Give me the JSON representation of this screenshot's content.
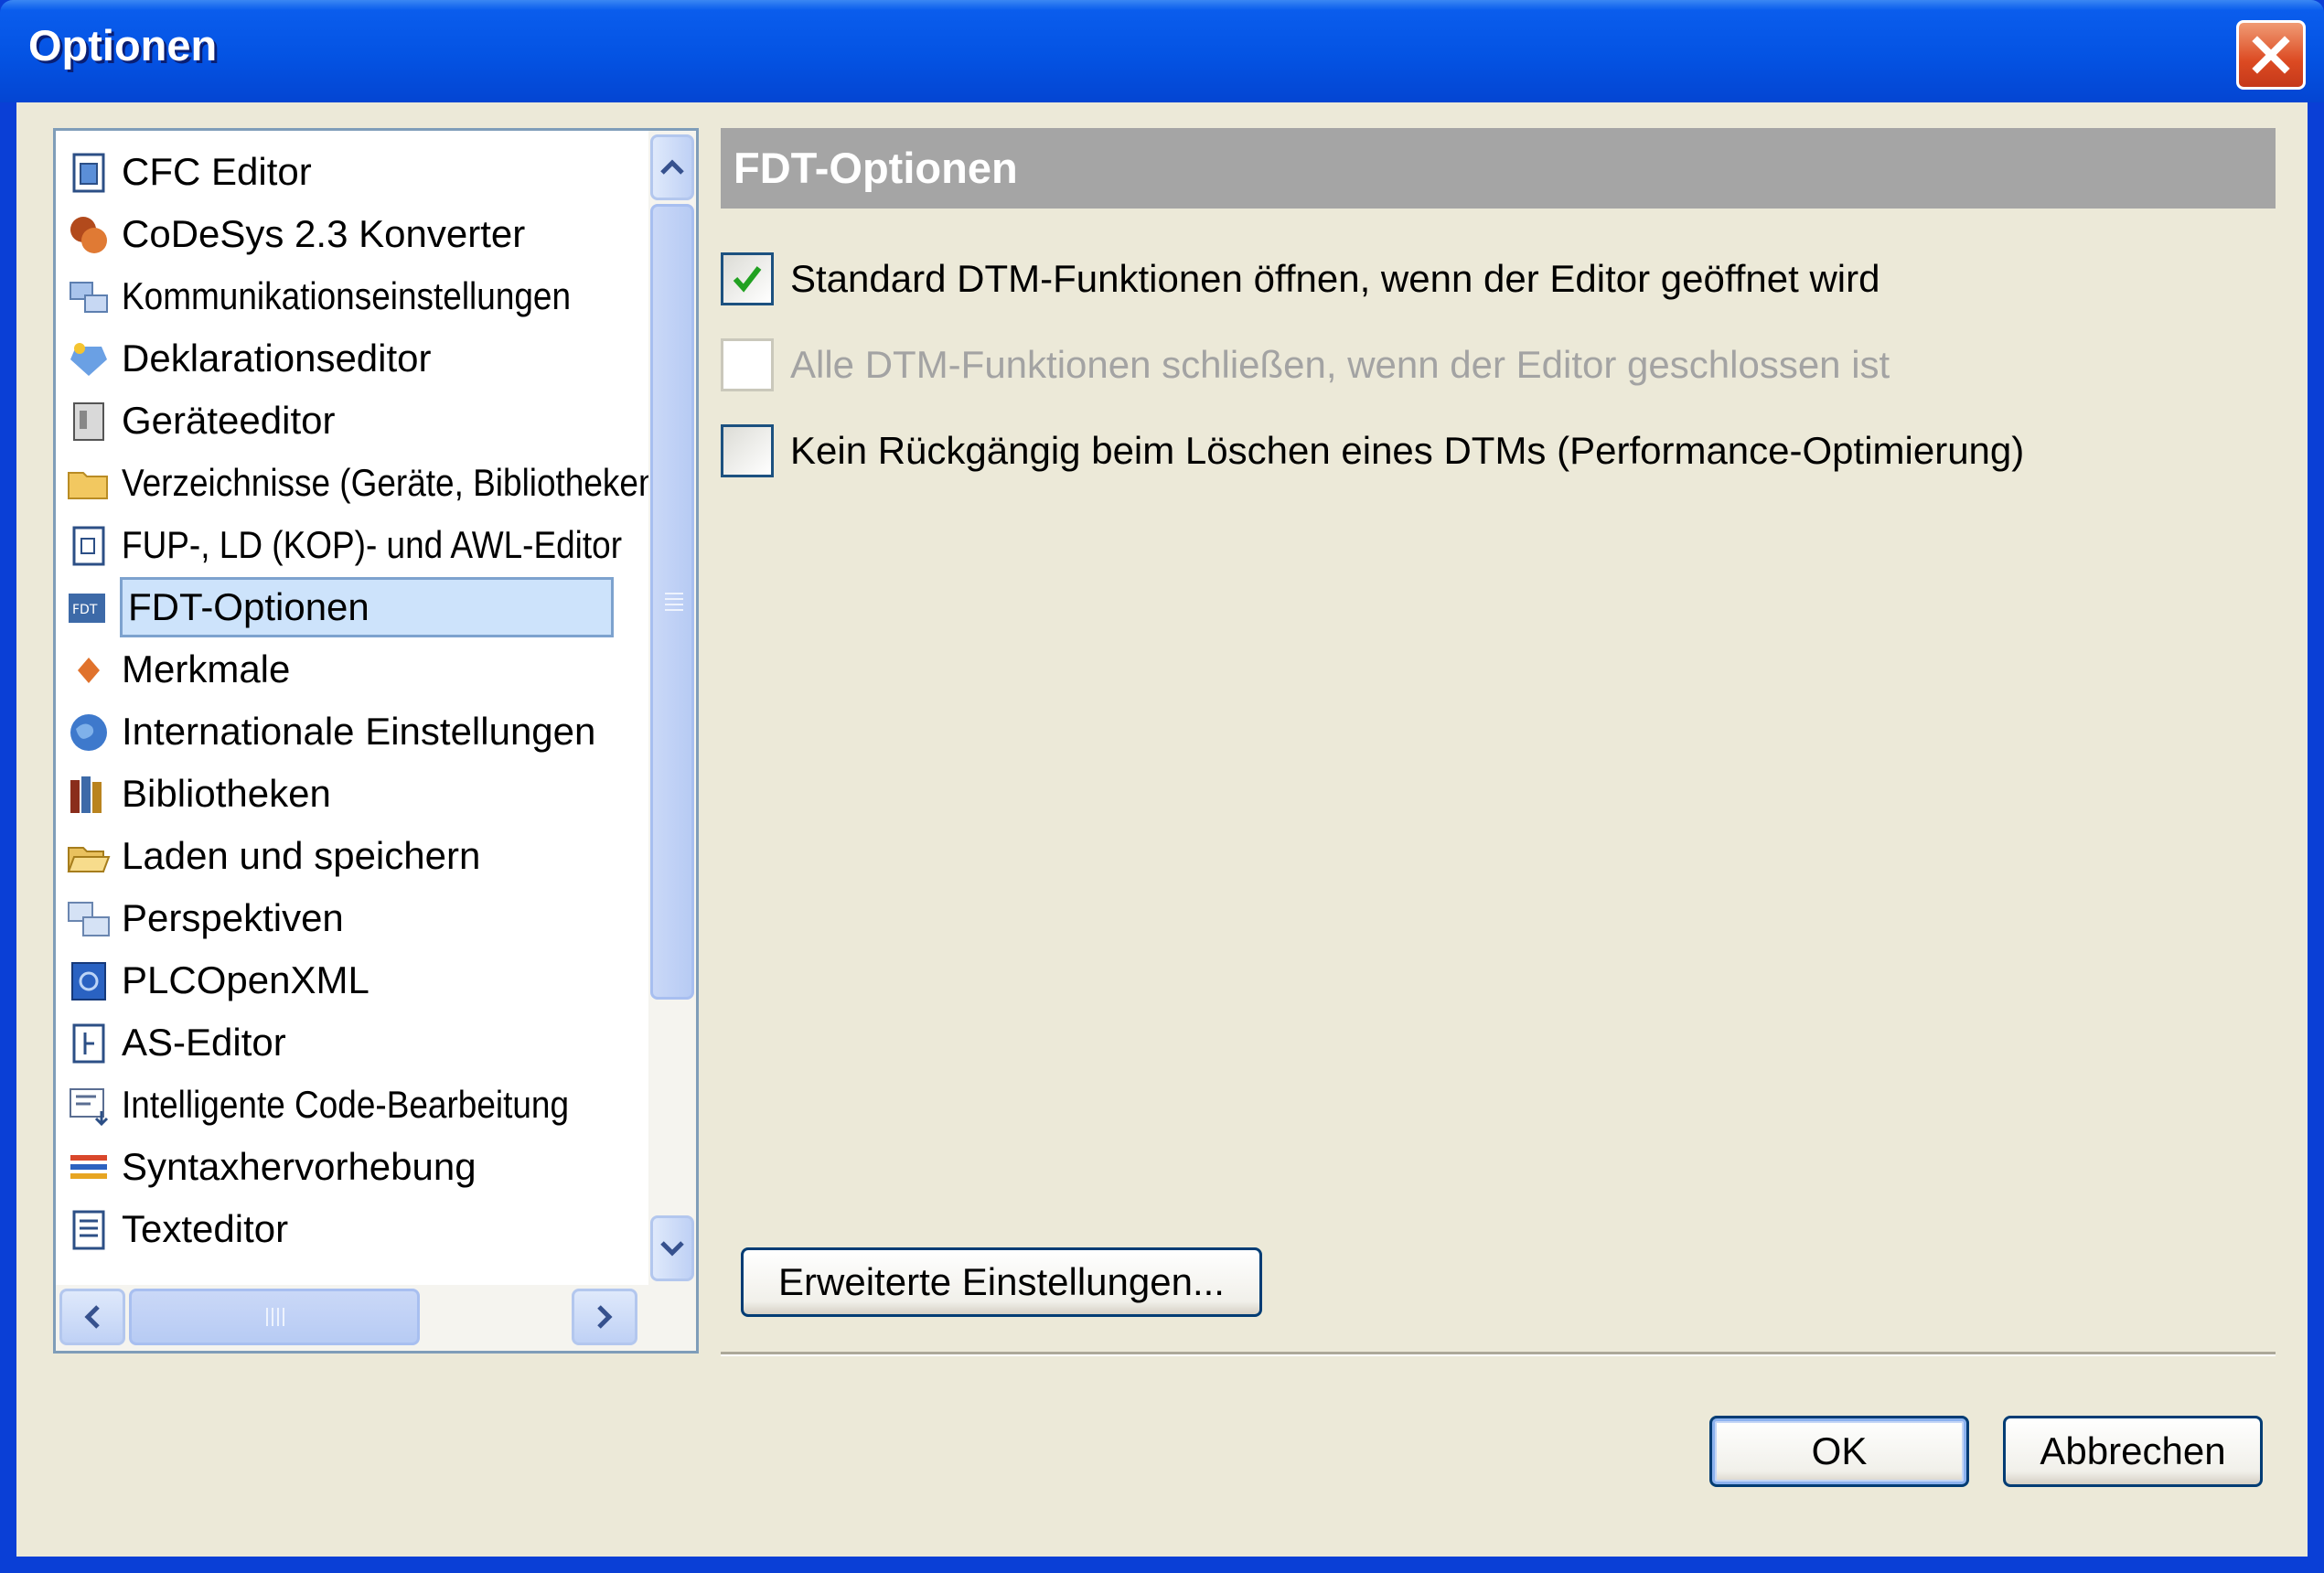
{
  "window": {
    "title": "Optionen"
  },
  "sidebar": {
    "items": [
      {
        "label": "CFC Editor",
        "icon": "cfc-editor-icon"
      },
      {
        "label": "CoDeSys 2.3 Konverter",
        "icon": "converter-icon"
      },
      {
        "label": "Kommunikationseinstellungen",
        "icon": "communication-icon"
      },
      {
        "label": "Deklarationseditor",
        "icon": "declaration-editor-icon"
      },
      {
        "label": "Geräteeditor",
        "icon": "device-editor-icon"
      },
      {
        "label": "Verzeichnisse (Geräte, Bibliotheken",
        "icon": "folder-icon"
      },
      {
        "label": "FUP-, LD (KOP)- und AWL-Editor",
        "icon": "fbd-ld-il-editor-icon"
      },
      {
        "label": "FDT-Optionen",
        "icon": "fdt-icon",
        "selected": true
      },
      {
        "label": "Merkmale",
        "icon": "features-icon"
      },
      {
        "label": "Internationale Einstellungen",
        "icon": "globe-icon"
      },
      {
        "label": "Bibliotheken",
        "icon": "libraries-icon"
      },
      {
        "label": "Laden und speichern",
        "icon": "open-folder-icon"
      },
      {
        "label": "Perspektiven",
        "icon": "perspectives-icon"
      },
      {
        "label": "PLCOpenXML",
        "icon": "plcopenxml-icon"
      },
      {
        "label": "AS-Editor",
        "icon": "sfc-editor-icon"
      },
      {
        "label": "Intelligente Code-Bearbeitung",
        "icon": "smart-coding-icon"
      },
      {
        "label": "Syntaxhervorhebung",
        "icon": "syntax-highlighting-icon"
      },
      {
        "label": "Texteditor",
        "icon": "text-editor-icon"
      }
    ]
  },
  "panel": {
    "title": "FDT-Optionen",
    "options": [
      {
        "label": "Standard DTM-Funktionen öffnen, wenn der Editor geöffnet wird",
        "checked": true,
        "enabled": true
      },
      {
        "label": "Alle DTM-Funktionen schließen, wenn der Editor geschlossen ist",
        "checked": false,
        "enabled": false
      },
      {
        "label": "Kein Rückgängig beim Löschen eines DTMs (Performance-Optimierung)",
        "checked": false,
        "enabled": true
      }
    ],
    "advanced_button": "Erweiterte Einstellungen..."
  },
  "footer": {
    "ok": "OK",
    "cancel": "Abbrechen"
  },
  "colors": {
    "titlebar": "#0453e3",
    "dialog_bg": "#ece9d8",
    "selection": "#cde3fb",
    "header_bg": "#a5a5a5"
  }
}
